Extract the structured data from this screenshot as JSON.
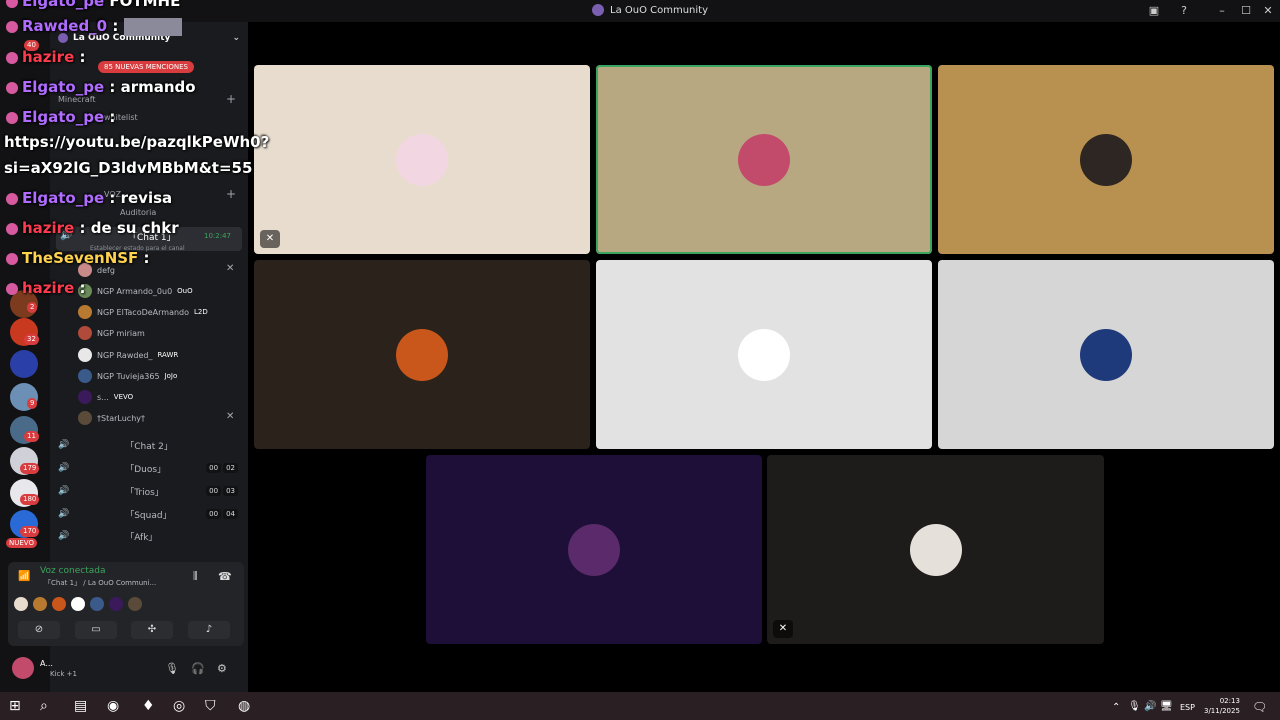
{
  "window": {
    "title": "La OuO Community"
  },
  "server": {
    "name": "La OuO Community",
    "mentions_badge": "85 NUEVAS MENCIONES"
  },
  "categories": [
    {
      "label": "Minecraft"
    },
    {
      "label": "VOZ"
    }
  ],
  "channels": {
    "whitelist": "whitelist",
    "auditoria": "Auditoria"
  },
  "active_channel": {
    "name": "「Chat 1」",
    "timer": "10:2:47",
    "subtext": "Establecer estado para el canal"
  },
  "members": [
    {
      "name": "defg",
      "tag": ""
    },
    {
      "name": "NGP Armando_0u0",
      "tag": "OuO"
    },
    {
      "name": "NGP ElTacoDeArmando",
      "tag": "L2D"
    },
    {
      "name": "NGP miriam",
      "tag": ""
    },
    {
      "name": "NGP Rawded_",
      "tag": "RAWR"
    },
    {
      "name": "NGP Tuvieja365",
      "tag": "JoJo"
    },
    {
      "name": "s...",
      "tag": "VEVO"
    },
    {
      "name": "†StarLuchy†",
      "tag": ""
    }
  ],
  "voice_channels": [
    {
      "name": "「Chat 2」",
      "c1": "",
      "c2": ""
    },
    {
      "name": "「Duos」",
      "c1": "00",
      "c2": "02"
    },
    {
      "name": "「Trios」",
      "c1": "00",
      "c2": "03"
    },
    {
      "name": "「Squad」",
      "c1": "00",
      "c2": "04"
    },
    {
      "name": "「Afk」",
      "c1": "",
      "c2": ""
    }
  ],
  "voice_panel": {
    "status": "Voz conectada",
    "channel": "「Chat 1」 / La OuO Communi..."
  },
  "user": {
    "name": "A...",
    "status": "Kick +1"
  },
  "guild_badges": [
    "40",
    "2",
    "32",
    "9",
    "11",
    "179",
    "180",
    "170"
  ],
  "guild_new": "NUEVO",
  "chat_overlay": [
    {
      "user": "Elgato_pe",
      "msg": "FOTMHE",
      "color": "#b06cff"
    },
    {
      "user": "Rawded_0",
      "msg": ":",
      "color": "#b06cff"
    },
    {
      "user": "hazire",
      "msg": ":",
      "color": "#ff3b4f"
    },
    {
      "user": "Elgato_pe",
      "msg": ": armando",
      "color": "#b06cff"
    },
    {
      "user": "Elgato_pe",
      "msg": ":",
      "color": "#b06cff"
    },
    {
      "user": "",
      "msg": "https://youtu.be/pazqlkPeWh0?",
      "color": "#fff"
    },
    {
      "user": "",
      "msg": "si=aX92lG_D3ldvMBbM&t=55",
      "color": "#fff"
    },
    {
      "user": "Elgato_pe",
      "msg": ": revisa",
      "color": "#b06cff"
    },
    {
      "user": "hazire",
      "msg": ": de su chkr",
      "color": "#ff3b4f"
    },
    {
      "user": "TheSevenNSF",
      "msg": ":",
      "color": "#ffd34d"
    },
    {
      "user": "hazire",
      "msg": ":",
      "color": "#ff3b4f"
    }
  ],
  "tiles": [
    {
      "bg": "#e8dccf",
      "avatar": "#f2d7e2",
      "muted": true,
      "speaking": false
    },
    {
      "bg": "#b8a882",
      "avatar": "#c24a6a",
      "muted": false,
      "speaking": true
    },
    {
      "bg": "#b89050",
      "avatar": "#2e2622",
      "muted": false,
      "speaking": false
    },
    {
      "bg": "#2c221c",
      "avatar": "#c9561a",
      "muted": false,
      "speaking": false
    },
    {
      "bg": "#e2e2e2",
      "avatar": "#ffffff",
      "muted": false,
      "speaking": false
    },
    {
      "bg": "#d6d6d6",
      "avatar": "#1f3a7a",
      "muted": false,
      "speaking": false
    },
    {
      "bg": "#1e0f38",
      "avatar": "#5a2a6a",
      "muted": false,
      "speaking": false
    },
    {
      "bg": "#1e1c1a",
      "avatar": "#e6e0da",
      "muted": true,
      "speaking": false
    }
  ],
  "taskbar": {
    "lang": "ESP",
    "time": "02:13",
    "date": "3/11/2025"
  },
  "colors": {
    "accent": "#5865f2",
    "online": "#3ba55d",
    "danger": "#d83c3e"
  }
}
